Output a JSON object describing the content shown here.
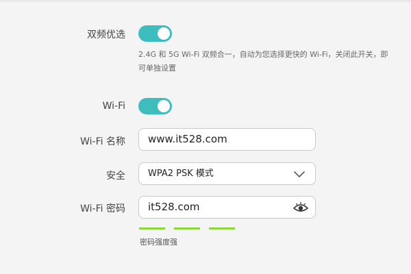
{
  "band_steering": {
    "label": "双频优选",
    "enabled": true,
    "hint": "2.4G 和 5G Wi-Fi 双频合一，自动为您选择更快的 Wi-Fi，关闭此开关，即可单独设置"
  },
  "wifi": {
    "label": "Wi-Fi",
    "enabled": true
  },
  "wifi_name": {
    "label": "Wi-Fi 名称",
    "value": "www.it528.com"
  },
  "security": {
    "label": "安全",
    "selected": "WPA2 PSK 模式"
  },
  "wifi_password": {
    "label": "Wi-Fi 密码",
    "value": "it528.com",
    "strength_label": "密码强度强",
    "strength_level": "3/3"
  },
  "colors": {
    "toggle_on": "#3dbdbd",
    "strength": "#8cd63b",
    "background": "#f4f4f4"
  }
}
